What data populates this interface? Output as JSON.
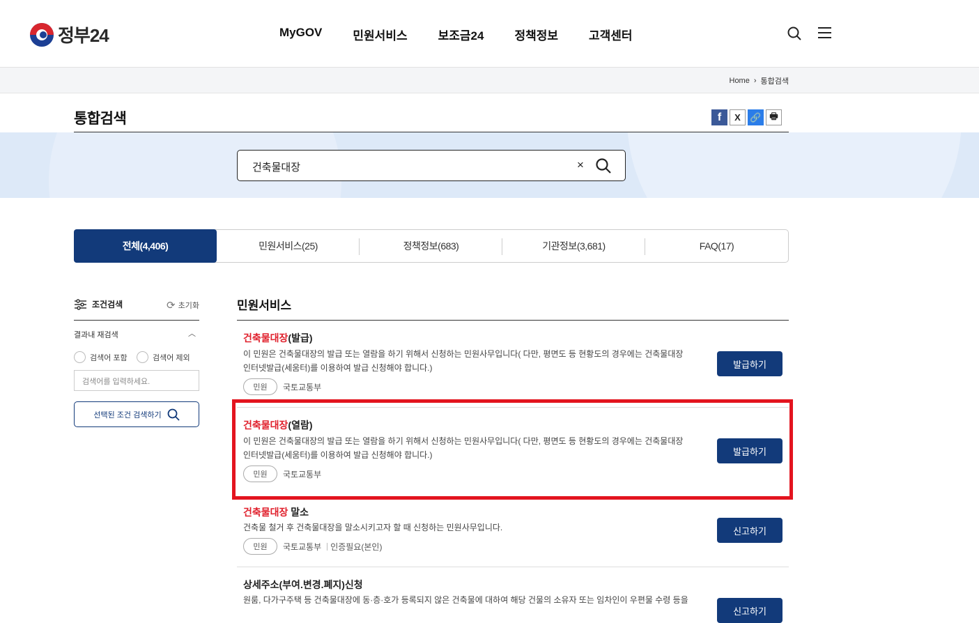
{
  "header": {
    "logo_text": "정부24",
    "nav": [
      "MyGOV",
      "민원서비스",
      "보조금24",
      "정책정보",
      "고객센터"
    ]
  },
  "breadcrumb": {
    "home": "Home",
    "current": "통합검색"
  },
  "page": {
    "title": "통합검색"
  },
  "share": {
    "facebook": "f",
    "x": "X",
    "link": "🔗",
    "print": "🖶"
  },
  "search": {
    "value": "건축물대장",
    "clear": "×"
  },
  "tabs": [
    {
      "label": "전체(4,406)",
      "active": true
    },
    {
      "label": "민원서비스(25)"
    },
    {
      "label": "정책정보(683)"
    },
    {
      "label": "기관정보(3,681)"
    },
    {
      "label": "FAQ(17)"
    }
  ],
  "filter": {
    "title": "조건검색",
    "reset": "초기화",
    "re_search_label": "결과내 재검색",
    "include": "검색어 포함",
    "exclude": "검색어 제외",
    "placeholder": "검색어를 입력하세요.",
    "apply_button": "선택된 조건 검색하기"
  },
  "results": {
    "section_title": "민원서비스",
    "items": [
      {
        "title_hl": "건축물대장",
        "title_rest": "(발급)",
        "desc1": "이 민원은 건축물대장의 발급 또는 열람을 하기 위해서 신청하는 민원사무입니다( 다만, 평면도 등 현황도의 경우에는 건축물대장",
        "desc2": "인터넷발급(세움터)를 이용하여 발급 신청해야 합니다.)",
        "tag": "민원",
        "agency": "국토교통부",
        "extra": "",
        "button": "발급하기"
      },
      {
        "title_hl": "건축물대장",
        "title_rest": "(열람)",
        "desc1": "이 민원은 건축물대장의 발급 또는 열람을 하기 위해서 신청하는 민원사무입니다( 다만, 평면도 등 현황도의 경우에는 건축물대장",
        "desc2": "인터넷발급(세움터)를 이용하여 발급 신청해야 합니다.)",
        "tag": "민원",
        "agency": "국토교통부",
        "extra": "",
        "button": "발급하기"
      },
      {
        "title_hl": "건축물대장",
        "title_rest": " 말소",
        "desc1": "건축물 철거 후 건축물대장을 말소시키고자 할 때 신청하는 민원사무입니다.",
        "desc2": "",
        "tag": "민원",
        "agency": "국토교통부",
        "extra": "인증필요(본인)",
        "button": "신고하기"
      },
      {
        "title_hl": "",
        "title_rest": "상세주소(부여.변경.폐지)신청",
        "desc1": "원룸, 다가구주택 등 건축물대장에 동·층·호가 등록되지 않은 건축물에 대하여 해당 건물의 소유자 또는 임차인이 우편물 수령 등을",
        "desc2": "",
        "tag": "",
        "agency": "",
        "extra": "",
        "button": "신고하기"
      }
    ]
  },
  "colors": {
    "primary": "#123a7a",
    "highlight": "#e0202c",
    "band": "#dde9f8"
  }
}
